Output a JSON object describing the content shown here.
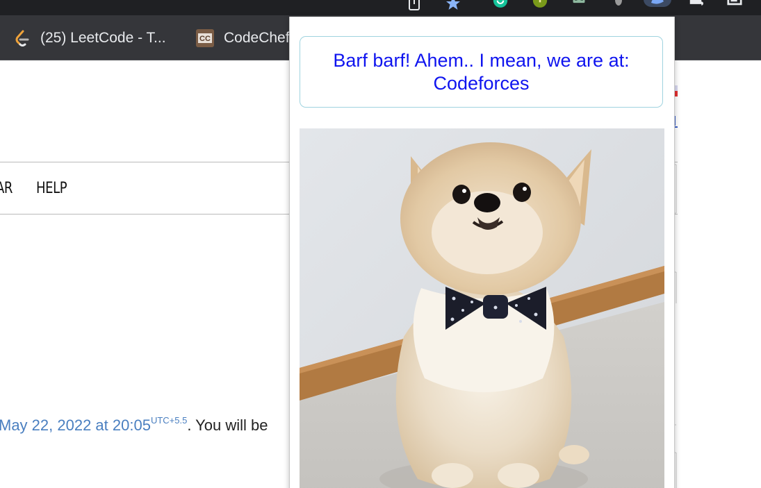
{
  "bookmarks": [
    {
      "label": "(25) LeetCode - T...",
      "icon": "leetcode-icon"
    },
    {
      "label": "CodeChef",
      "icon": "codechef-icon"
    }
  ],
  "toolbar_icons": [
    "share-icon",
    "bookmark-star-icon",
    "grammarly-icon",
    "extension-green-icon",
    "extension-robot-icon",
    "extension-grey-icon",
    "dog-extension-icon",
    "extensions-puzzle-icon",
    "profile-window-icon"
  ],
  "page": {
    "nav_items": [
      "AR",
      "HELP"
    ],
    "contest": {
      "date_text": "May 22, 2022 at 20:05",
      "timezone": "UTC+5.5",
      "tail_text": ". You will be"
    }
  },
  "popup": {
    "banner_text": "Barf barf! Ahem.. I mean, we are at: Codeforces",
    "banner_color": "#0f14ef",
    "photo_subject": "pomeranian-dog-with-bow-tie"
  },
  "colors": {
    "browser_dark": "#1f2023",
    "bookmarks_bar": "#35363a",
    "link_blue": "#4a7fc0"
  }
}
